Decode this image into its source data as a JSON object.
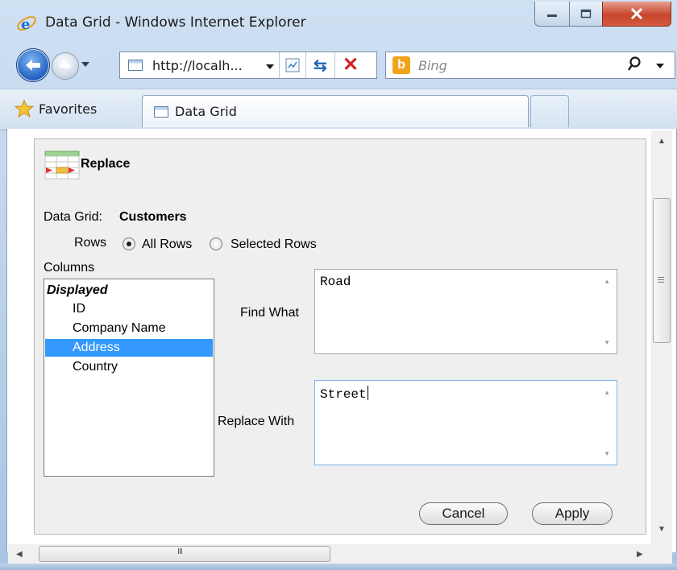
{
  "window": {
    "title": "Data Grid - Windows Internet Explorer"
  },
  "navigation": {
    "address": "http://localh...",
    "search_placeholder": "Bing"
  },
  "favorites_bar": {
    "favorites_label": "Favorites",
    "active_tab_label": "Data Grid"
  },
  "dialog": {
    "title": "Replace",
    "data_grid_label": "Data Grid:",
    "data_grid_value": "Customers",
    "rows_label": "Rows",
    "row_options": [
      {
        "label": "All Rows",
        "selected": true
      },
      {
        "label": "Selected Rows",
        "selected": false
      }
    ],
    "columns_label": "Columns",
    "columns_group": "Displayed",
    "columns": [
      {
        "label": "ID",
        "selected": false
      },
      {
        "label": "Company Name",
        "selected": false
      },
      {
        "label": "Address",
        "selected": true
      },
      {
        "label": "Country",
        "selected": false
      }
    ],
    "find_what_label": "Find What",
    "find_what_value": "Road",
    "replace_with_label": "Replace With",
    "replace_with_value": "Street",
    "cancel_label": "Cancel",
    "apply_label": "Apply"
  },
  "scrollbar": {
    "horizontal_grip": "III"
  },
  "colors": {
    "selection": "#3399ff",
    "panel_background": "#efefef",
    "close_button": "#c8452c"
  }
}
